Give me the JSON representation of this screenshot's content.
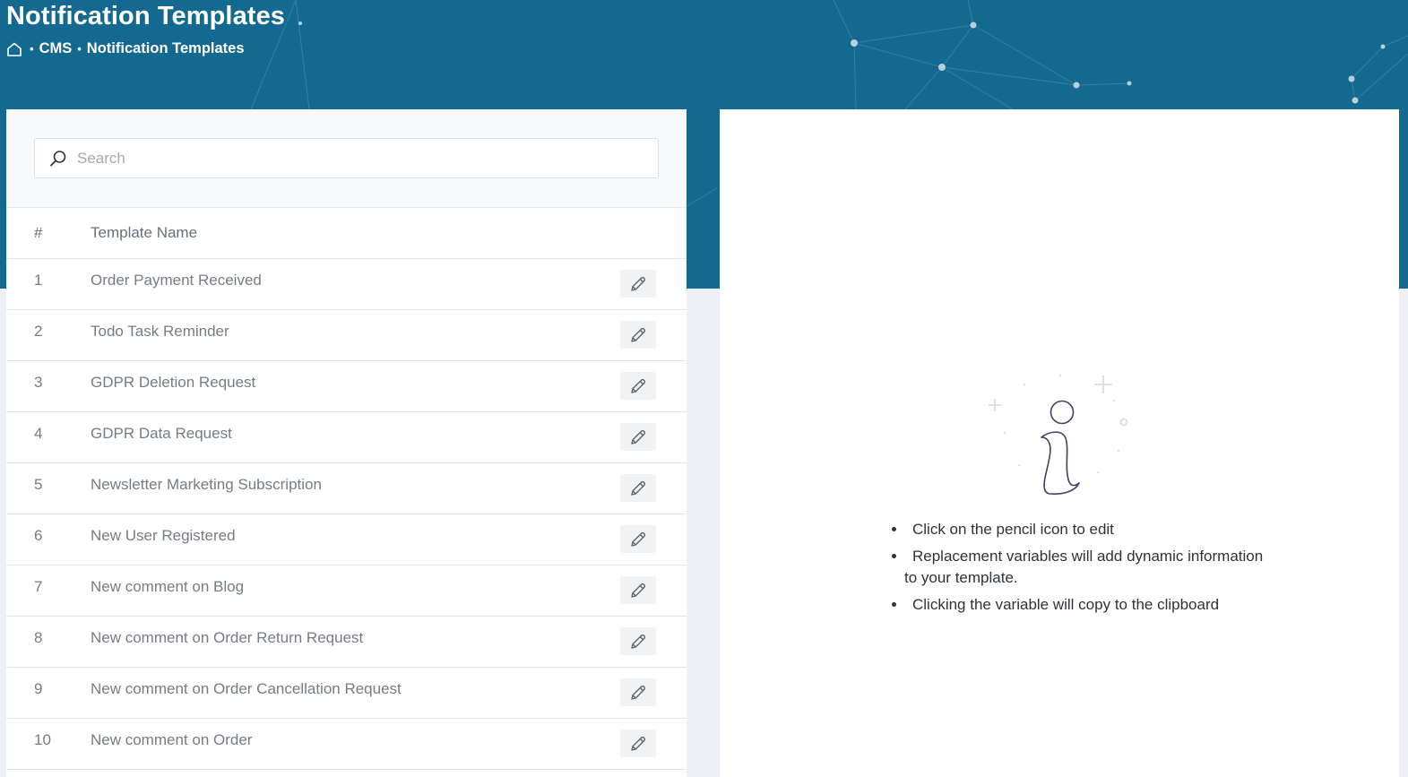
{
  "header": {
    "title": "Notification Templates",
    "breadcrumb": {
      "home_icon": "home-icon",
      "items": [
        "CMS",
        "Notification Templates"
      ],
      "separator": "•"
    },
    "colors": {
      "banner": "#13698f",
      "page_bg": "#eef0f8"
    }
  },
  "search": {
    "icon": "search-icon",
    "placeholder": "Search",
    "value": ""
  },
  "table": {
    "columns": [
      "#",
      "Template Name"
    ],
    "row_action_icon": "pencil-icon",
    "rows": [
      {
        "num": "1",
        "name": "Order Payment Received"
      },
      {
        "num": "2",
        "name": "Todo Task Reminder"
      },
      {
        "num": "3",
        "name": "GDPR Deletion Request"
      },
      {
        "num": "4",
        "name": "GDPR Data Request"
      },
      {
        "num": "5",
        "name": "Newsletter Marketing Subscription"
      },
      {
        "num": "6",
        "name": "New User Registered"
      },
      {
        "num": "7",
        "name": "New comment on Blog"
      },
      {
        "num": "8",
        "name": "New comment on Order Return Request"
      },
      {
        "num": "9",
        "name": "New comment on Order Cancellation Request"
      },
      {
        "num": "10",
        "name": "New comment on Order"
      }
    ]
  },
  "info_panel": {
    "illustration_icon": "info-icon",
    "tips": [
      "Click on the pencil icon to edit",
      "Replacement variables will add dynamic information to your template.",
      "Clicking the variable will copy to the clipboard"
    ]
  }
}
